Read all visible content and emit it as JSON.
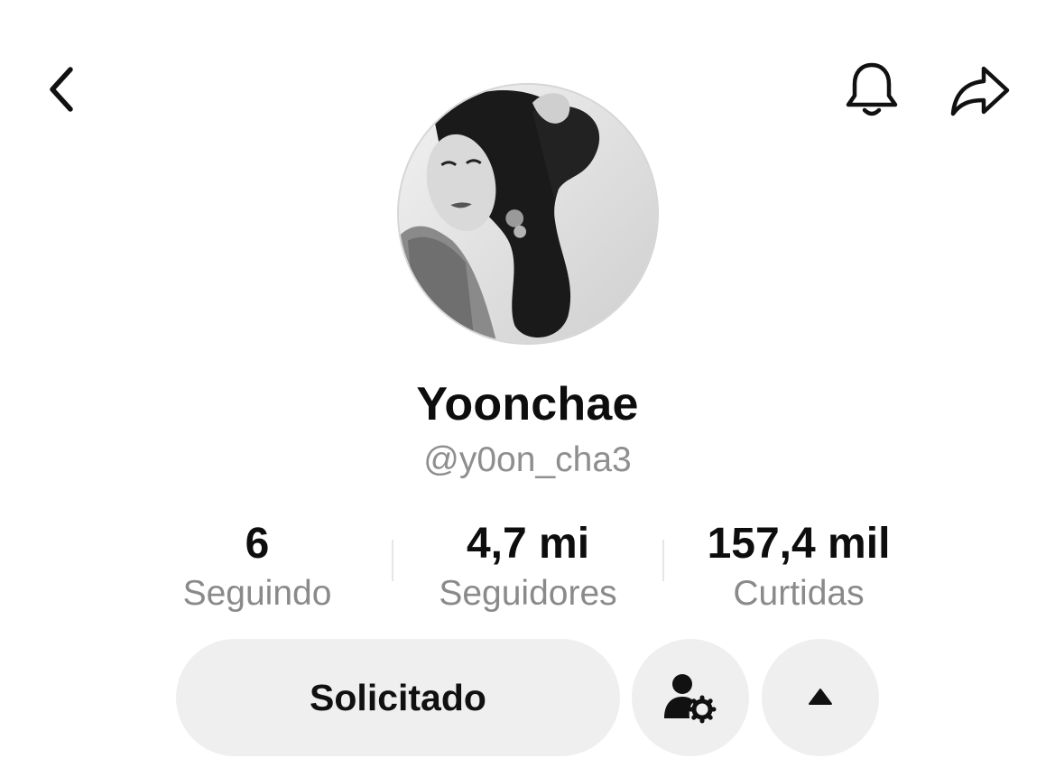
{
  "top_bar": {
    "back_icon": "chevron-left-icon",
    "notifications_icon": "bell-icon",
    "share_icon": "share-arrow-icon"
  },
  "profile": {
    "display_name": "Yoonchae",
    "username": "@y0on_cha3",
    "avatar": "black-and-white portrait photo"
  },
  "stats": [
    {
      "value": "6",
      "label": "Seguindo"
    },
    {
      "value": "4,7 mi",
      "label": "Seguidores"
    },
    {
      "value": "157,4 mil",
      "label": "Curtidas"
    }
  ],
  "actions": {
    "follow_status_label": "Solicitado",
    "user_settings_icon": "user-gear-icon",
    "expand_icon": "triangle-up-icon"
  },
  "colors": {
    "text": "#111111",
    "muted": "#8a8a8a",
    "button_bg": "#efefef",
    "background": "#ffffff"
  }
}
